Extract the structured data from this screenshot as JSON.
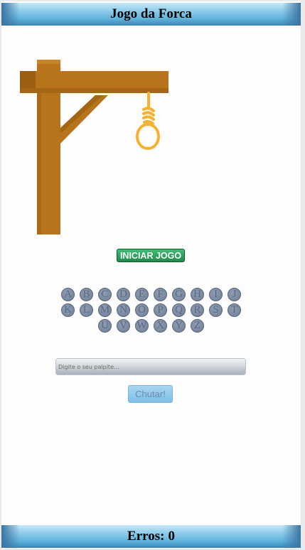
{
  "header": {
    "title": "Jogo da Forca"
  },
  "game": {
    "start_label": "INICIAR JOGO",
    "letters": [
      [
        "A",
        "B",
        "C",
        "D",
        "E",
        "F",
        "G",
        "H",
        "I",
        "J"
      ],
      [
        "K",
        "L",
        "M",
        "N",
        "O",
        "P",
        "Q",
        "R",
        "S",
        "T"
      ],
      [
        "U",
        "V",
        "W",
        "X",
        "Y",
        "Z"
      ]
    ],
    "guess_placeholder": "Digite o seu palpite...",
    "guess_button": "Chutar!",
    "errors_label": "Erros:",
    "errors_value": "0"
  },
  "colors": {
    "bar": "#5fb3db",
    "start": "#2ea65f",
    "wood": "#b8741a",
    "rope": "#f5b12f",
    "key": "#7b8aa0"
  }
}
